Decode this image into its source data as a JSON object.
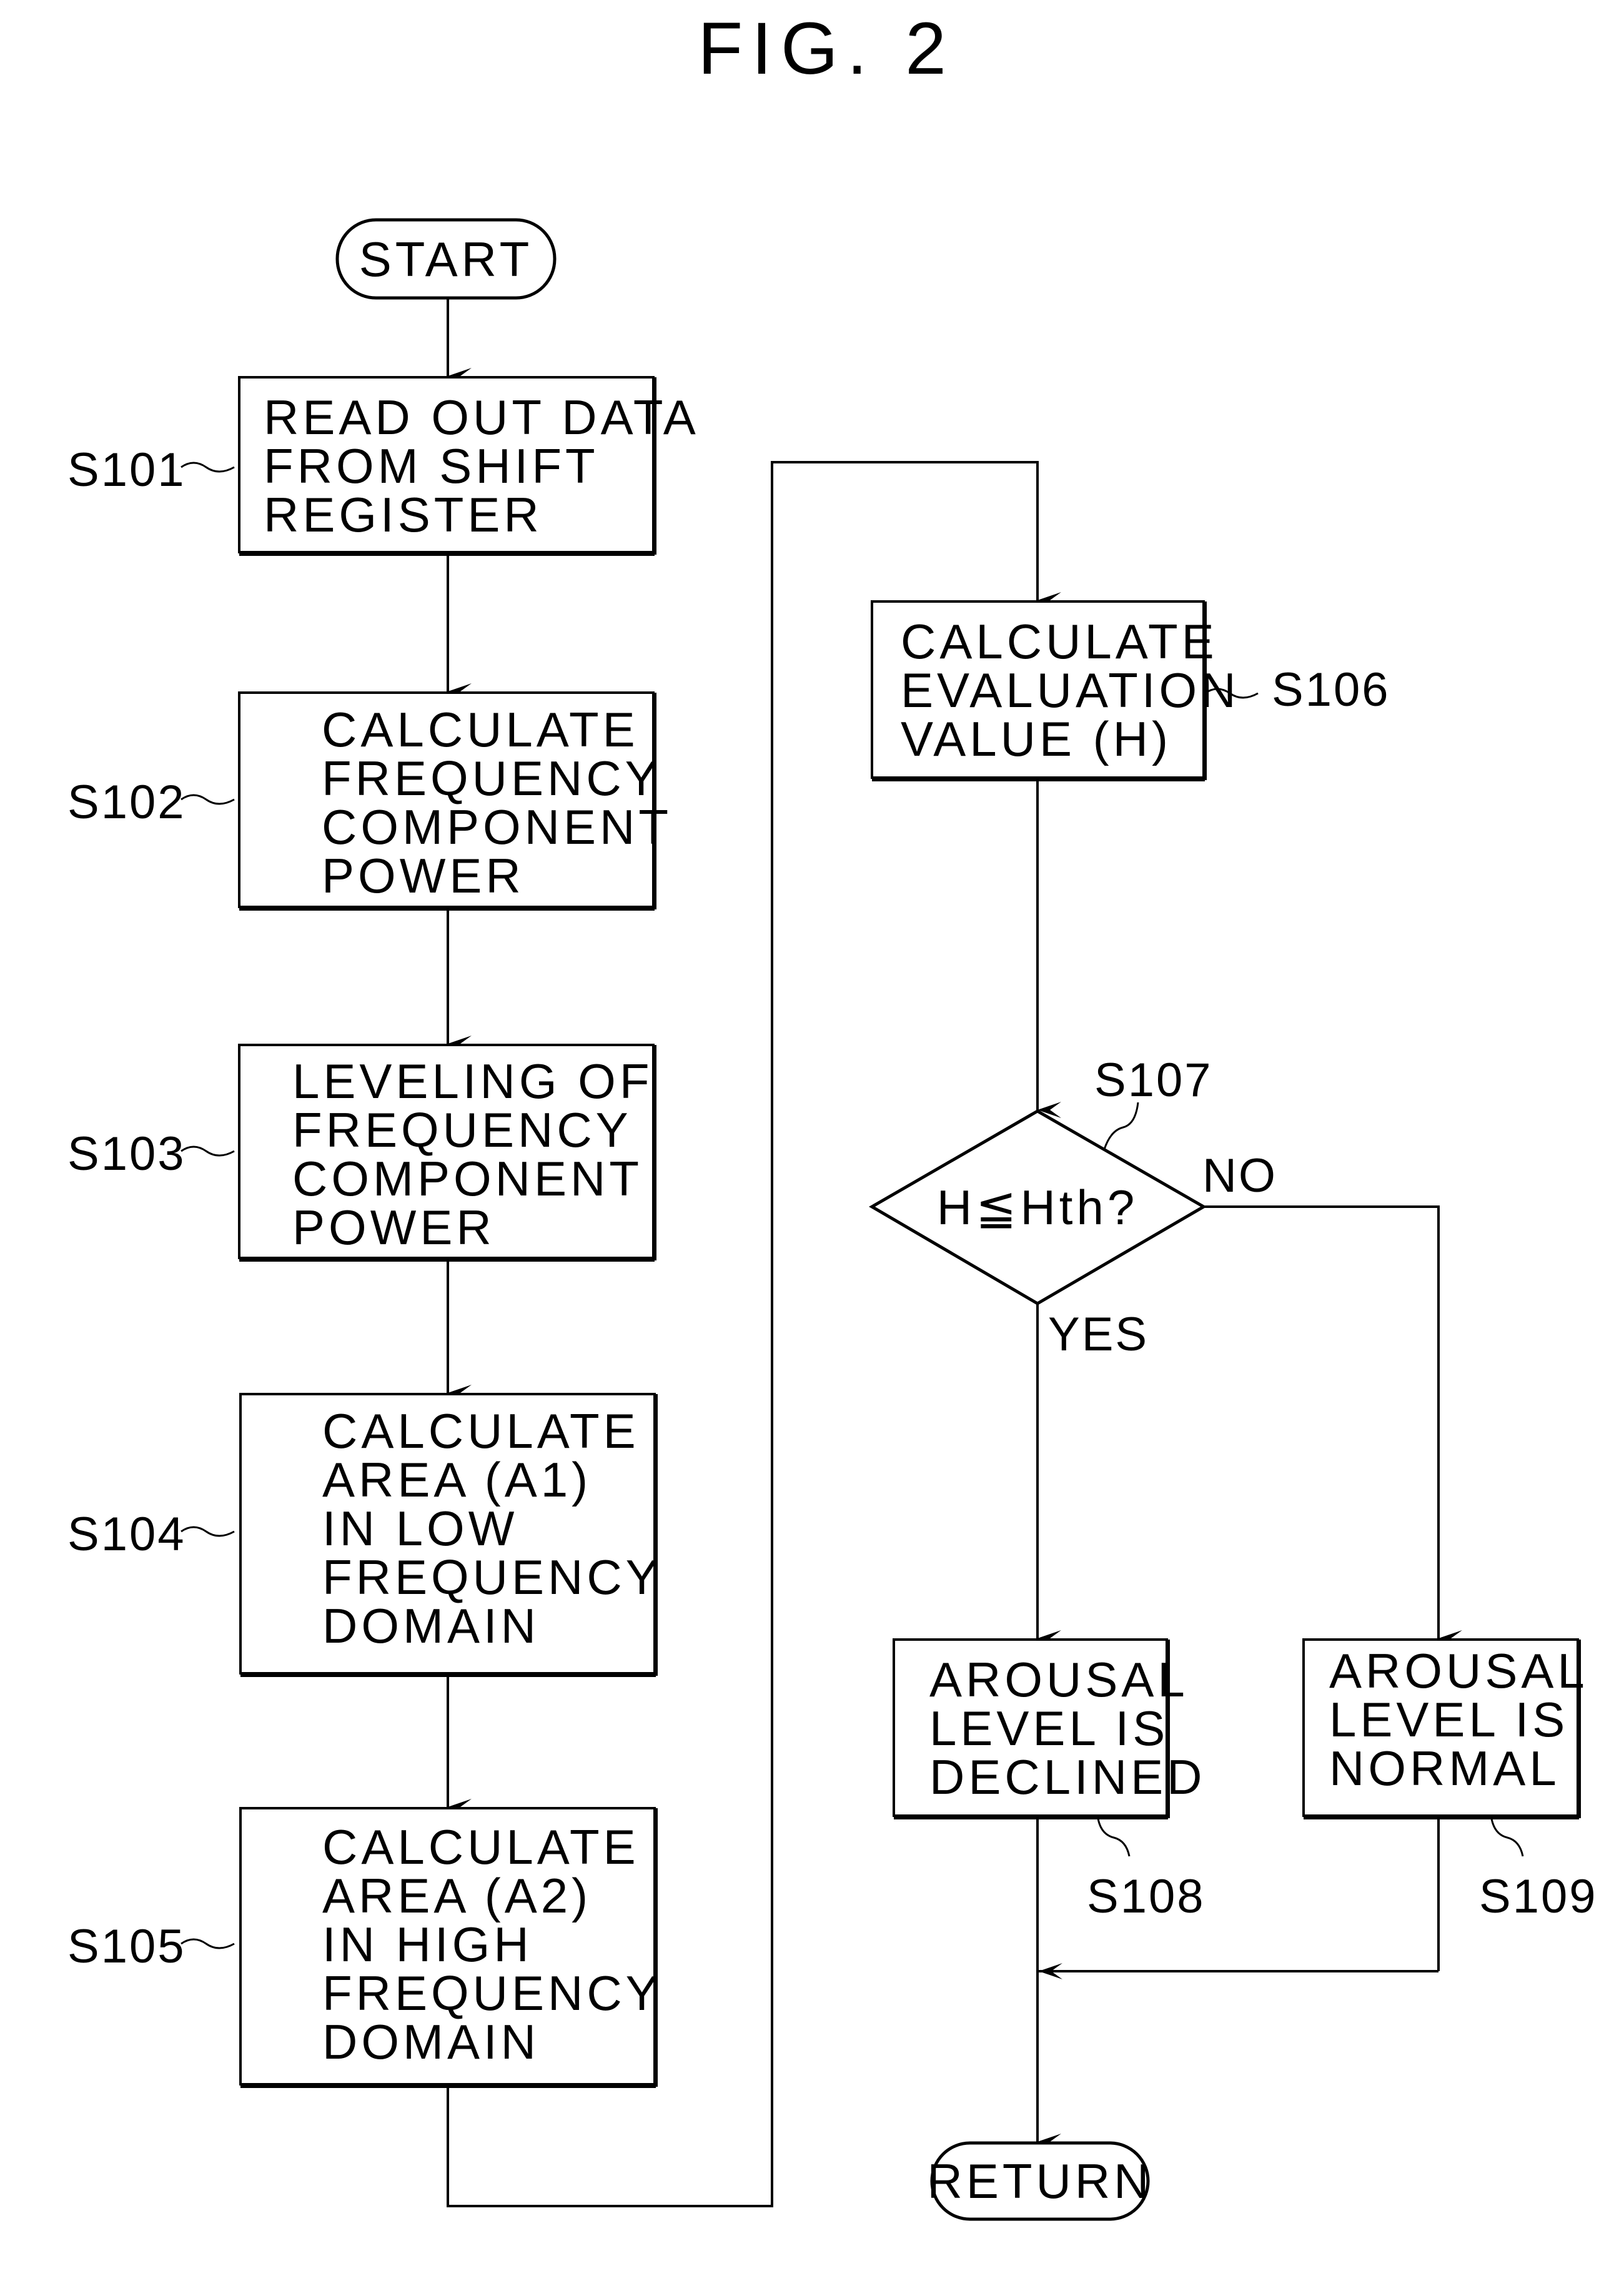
{
  "figure": {
    "title": "FIG. 2"
  },
  "terminals": {
    "start": "START",
    "return": "RETURN"
  },
  "steps": [
    {
      "id": "S101",
      "lines": [
        "READ OUT DATA",
        "FROM SHIFT",
        "REGISTER"
      ]
    },
    {
      "id": "S102",
      "lines": [
        "CALCULATE",
        "FREQUENCY",
        "COMPONENT",
        "POWER"
      ]
    },
    {
      "id": "S103",
      "lines": [
        "LEVELING OF",
        "FREQUENCY",
        "COMPONENT",
        "POWER"
      ]
    },
    {
      "id": "S104",
      "lines": [
        "CALCULATE",
        "AREA (A1)",
        "IN LOW",
        "FREQUENCY",
        "DOMAIN"
      ]
    },
    {
      "id": "S105",
      "lines": [
        "CALCULATE",
        "AREA (A2)",
        "IN HIGH",
        "FREQUENCY",
        "DOMAIN"
      ]
    },
    {
      "id": "S106",
      "lines": [
        "CALCULATE",
        "EVALUATION",
        "VALUE (H)"
      ]
    },
    {
      "id": "S108",
      "lines": [
        "AROUSAL",
        "LEVEL IS",
        "DECLINED"
      ]
    },
    {
      "id": "S109",
      "lines": [
        "AROUSAL",
        "LEVEL IS",
        "NORMAL"
      ]
    }
  ],
  "decision": {
    "id": "S107",
    "condition": "H≦Hth?",
    "yes_label": "YES",
    "no_label": "NO"
  }
}
